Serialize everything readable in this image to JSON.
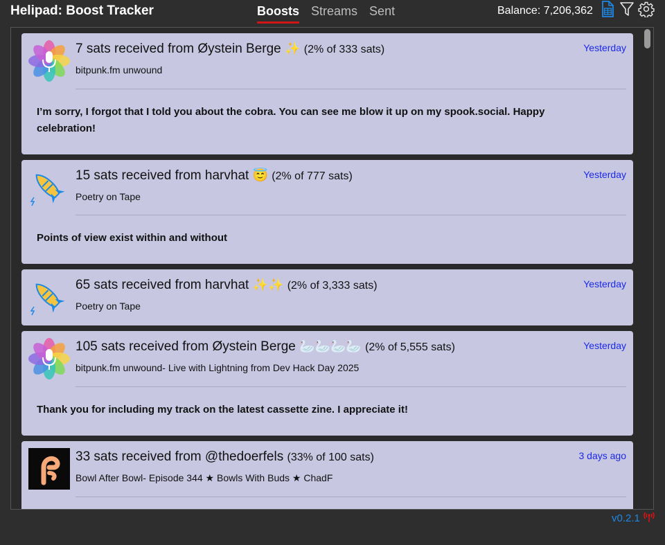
{
  "header": {
    "title": "Helipad: Boost Tracker",
    "tabs": [
      {
        "label": "Boosts",
        "active": true
      },
      {
        "label": "Streams",
        "active": false
      },
      {
        "label": "Sent",
        "active": false
      }
    ],
    "balance": "Balance: 7,206,362",
    "icons": [
      "csv-export-icon",
      "filter-icon",
      "gear-icon"
    ]
  },
  "boosts": [
    {
      "amount_text": "7 sats received from Øystein Berge",
      "emoji": "✨",
      "split": "(2% of 333 sats)",
      "podcast": "bitpunk.fm unwound",
      "time": "Yesterday",
      "message": "I’m sorry, I forgot that I told you about the cobra. You can see me blow it up on my spook.social. Happy celebration!",
      "avatar": "flower-microphone-icon"
    },
    {
      "amount_text": "15 sats received from harvhat",
      "emoji": "😇",
      "split": "(2% of 777 sats)",
      "podcast": "Poetry on Tape",
      "time": "Yesterday",
      "message": "Points of view exist within and without",
      "avatar": "rocket-icon"
    },
    {
      "amount_text": "65 sats received from harvhat",
      "emoji": "✨✨",
      "split": "(2% of 3,333 sats)",
      "podcast": "Poetry on Tape",
      "time": "Yesterday",
      "message": "",
      "avatar": "rocket-icon"
    },
    {
      "amount_text": "105 sats received from Øystein Berge",
      "emoji": "🦢🦢🦢🦢",
      "split": "(2% of 5,555 sats)",
      "podcast": "bitpunk.fm unwound- Live with Lightning from Dev Hack Day 2025",
      "time": "Yesterday",
      "message": "Thank you for including my track on the latest cassette zine. I appreciate it!",
      "avatar": "flower-microphone-icon"
    },
    {
      "amount_text": "33 sats received from @thedoerfels",
      "emoji": "",
      "split": "(33% of 100 sats)",
      "podcast": "Bowl After Bowl- Episode 344 ★ Bowls With Buds ★ ChadF",
      "time": "3 days ago",
      "message": "",
      "avatar": "podcast-logo-f-icon"
    }
  ],
  "footer": {
    "version": "v0.2.1",
    "status_icon": "broadcast-signal-icon"
  },
  "colors": {
    "card_bg": "#c8c7e2",
    "time_link": "#1a29e6",
    "tab_underline": "#d41515",
    "version": "#1e88e5",
    "signal": "#d41515"
  }
}
